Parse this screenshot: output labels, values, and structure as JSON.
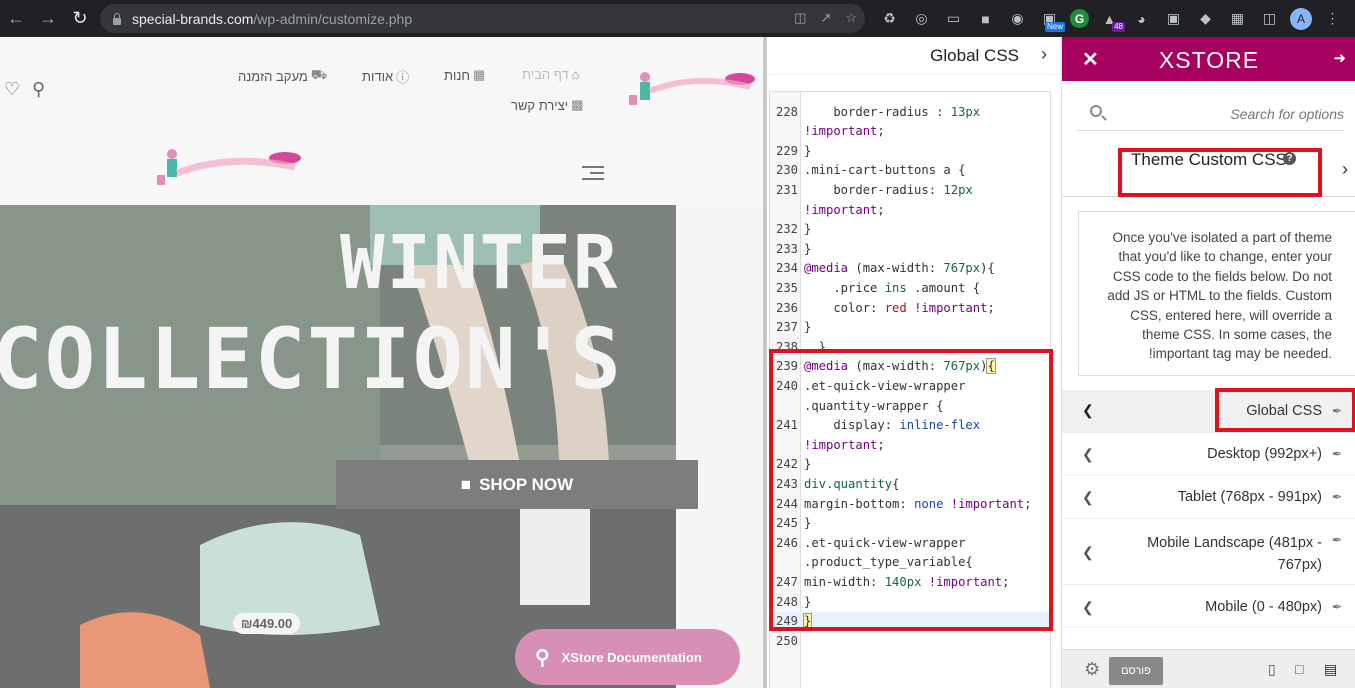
{
  "browser": {
    "url_host": "special-brands.com",
    "url_path": "/wp-admin/customize.php",
    "ext_new_badge": "New",
    "ext_count_badge": "48",
    "ext_g_letter": "G",
    "avatar_letter": "A"
  },
  "site": {
    "menu": [
      {
        "label": "דף הבית",
        "active": true
      },
      {
        "label": "חנות"
      },
      {
        "label": "אודות"
      },
      {
        "label": "מעקב הזמנה"
      },
      {
        "label": "יצירת קשר"
      }
    ],
    "hero_line1": "WINTER",
    "hero_line2": "COLLECTION'S",
    "shop_now": "SHOP NOW",
    "price": "₪449.00",
    "doc_button": "XStore Documentation"
  },
  "editor": {
    "title": "Global CSS",
    "lines": [
      {
        "n": "",
        "t": "    ",
        "top": 0
      },
      {
        "n": "228",
        "t": "    border-radius : 13px"
      },
      {
        "n": "",
        "t": "!important;"
      },
      {
        "n": "229",
        "t": "}"
      },
      {
        "n": "230",
        "t": ".mini-cart-buttons a {"
      },
      {
        "n": "231",
        "t": "    border-radius: 12px"
      },
      {
        "n": "",
        "t": "!important;"
      },
      {
        "n": "232",
        "t": "}"
      },
      {
        "n": "233",
        "t": "}"
      },
      {
        "n": "234",
        "t": "@media (max-width: 767px){"
      },
      {
        "n": "235",
        "t": "    .price ins .amount {"
      },
      {
        "n": "236",
        "t": "    color: red !important;"
      },
      {
        "n": "237",
        "t": "}"
      },
      {
        "n": "238",
        "t": "  }"
      },
      {
        "n": "239",
        "t": "@media (max-width: 767px){"
      },
      {
        "n": "240",
        "t": ".et-quick-view-wrapper"
      },
      {
        "n": "",
        "t": ".quantity-wrapper {"
      },
      {
        "n": "241",
        "t": "    display: inline-flex"
      },
      {
        "n": "",
        "t": "!important;"
      },
      {
        "n": "242",
        "t": "}"
      },
      {
        "n": "243",
        "t": "div.quantity{"
      },
      {
        "n": "244",
        "t": "margin-bottom: none !important;"
      },
      {
        "n": "245",
        "t": "}"
      },
      {
        "n": "246",
        "t": ".et-quick-view-wrapper"
      },
      {
        "n": "",
        "t": ".product_type_variable{"
      },
      {
        "n": "247",
        "t": "min-width: 140px !important;"
      },
      {
        "n": "248",
        "t": "}"
      },
      {
        "n": "249",
        "t": "}"
      },
      {
        "n": "250",
        "t": ""
      }
    ]
  },
  "panel": {
    "brand": "XSTORE",
    "search_placeholder": "Search for options",
    "section_title": "Theme Custom CSS",
    "help_mark": "?",
    "description": "Once you've isolated a part of theme that you'd like to change, enter your CSS code to the fields below. Do not add JS or HTML to the fields. Custom CSS, entered here, will override a theme CSS. In some cases, the !important tag may be needed.",
    "options": [
      {
        "label": "Global CSS",
        "active": true
      },
      {
        "label": "Desktop (992px+)"
      },
      {
        "label": "Tablet (768px - 991px)"
      },
      {
        "label": "Mobile Landscape (481px - 767px)"
      },
      {
        "label": "Mobile (0 - 480px)"
      }
    ],
    "publish": "פורסם"
  },
  "colors": {
    "brand": "#a8005e",
    "highlight": "#e0101d",
    "doc_button": "#d88fb5"
  }
}
